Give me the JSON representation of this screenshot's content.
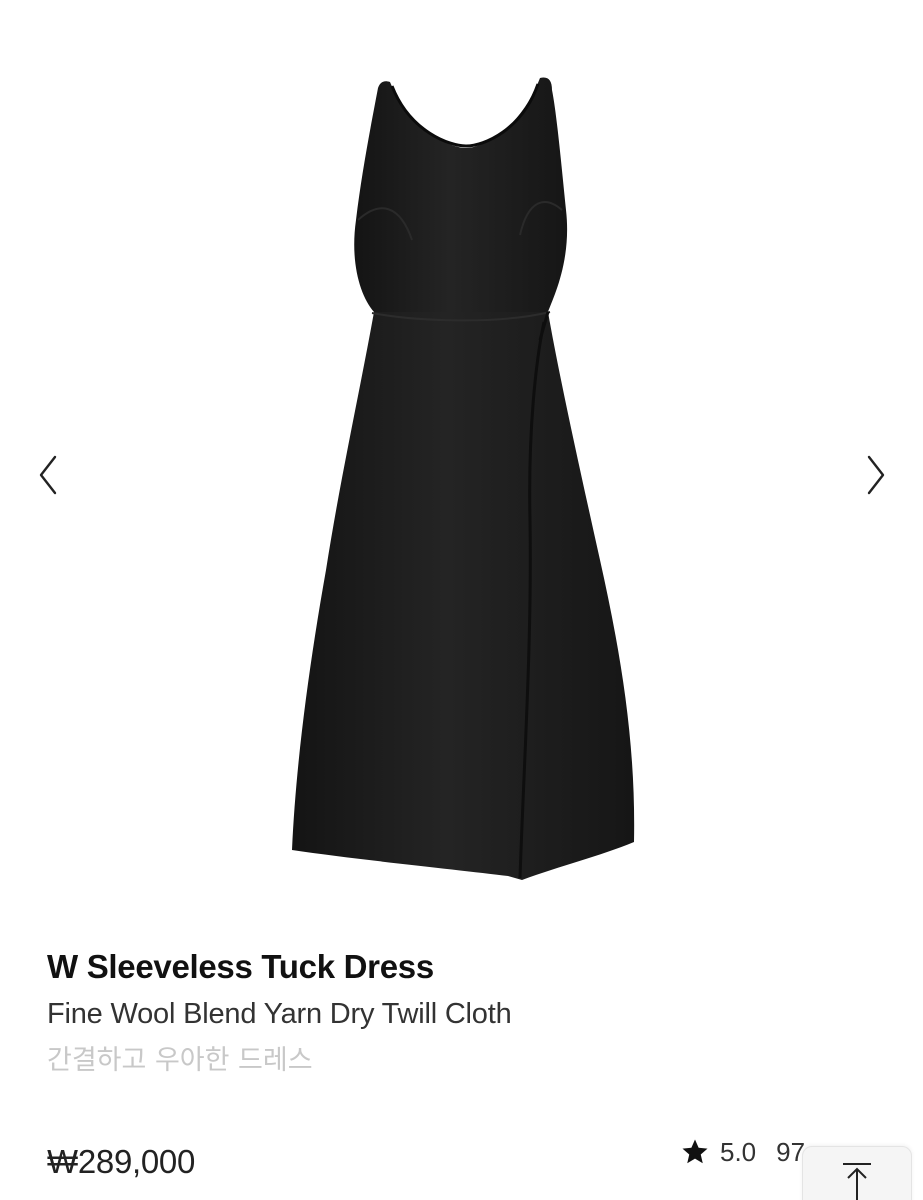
{
  "gallery": {
    "image_alt": "Black sleeveless dress",
    "prev_icon": "chevron-left-icon",
    "next_icon": "chevron-right-icon"
  },
  "product": {
    "title": "W Sleeveless Tuck Dress",
    "subtitle": "Fine Wool Blend Yarn Dry Twill Cloth",
    "tagline": "간결하고 우아한 드레스",
    "price": "₩289,000",
    "rating": "5.0",
    "review_count": "97"
  },
  "colors": {
    "dress": "#1c1c1c",
    "tagline": "#c8c8c8",
    "accent_text": "#111111"
  },
  "icons": {
    "rating": "star-icon",
    "scroll_top": "arrow-up-to-top-icon"
  }
}
